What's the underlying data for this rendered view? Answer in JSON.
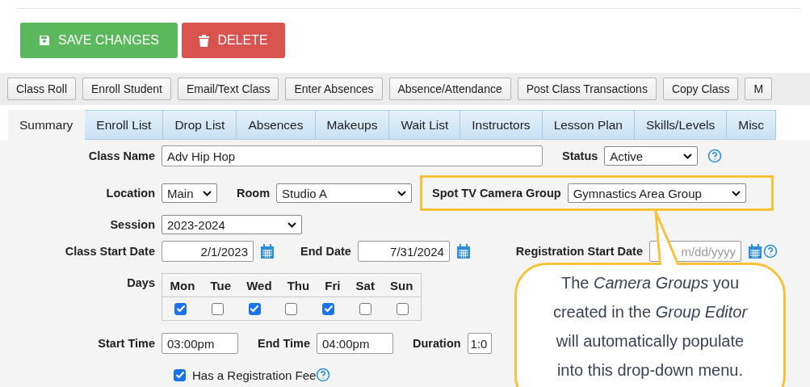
{
  "actions": [
    {
      "label": "SAVE CHANGES",
      "kind": "save"
    },
    {
      "label": "DELETE",
      "kind": "delete"
    }
  ],
  "toolbar": [
    "Class Roll",
    "Enroll Student",
    "Email/Text Class",
    "Enter Absences",
    "Absence/Attendance",
    "Post Class Transactions",
    "Copy Class",
    "M"
  ],
  "tabs": [
    {
      "label": "Summary",
      "selected": true
    },
    {
      "label": "Enroll List",
      "selected": false
    },
    {
      "label": "Drop List",
      "selected": false
    },
    {
      "label": "Absences",
      "selected": false
    },
    {
      "label": "Makeups",
      "selected": false
    },
    {
      "label": "Wait List",
      "selected": false
    },
    {
      "label": "Instructors",
      "selected": false
    },
    {
      "label": "Lesson Plan",
      "selected": false
    },
    {
      "label": "Skills/Levels",
      "selected": false
    },
    {
      "label": "Misc",
      "selected": false
    }
  ],
  "form": {
    "class_name": {
      "label": "Class Name",
      "value": "Adv Hip Hop"
    },
    "status": {
      "label": "Status",
      "value": "Active"
    },
    "location": {
      "label": "Location",
      "value": "Main"
    },
    "room": {
      "label": "Room",
      "value": "Studio A"
    },
    "camera_group": {
      "label": "Spot TV Camera Group",
      "value": "Gymnastics Area Group"
    },
    "session": {
      "label": "Session",
      "value": "2023-2024"
    },
    "class_start_date": {
      "label": "Class Start Date",
      "value": "2/1/2023"
    },
    "end_date": {
      "label": "End Date",
      "value": "7/31/2024"
    },
    "registration_start_date": {
      "label": "Registration Start Date",
      "placeholder": "m/dd/yyyy"
    },
    "days": {
      "label": "Days",
      "items": [
        {
          "label": "Mon",
          "checked": true
        },
        {
          "label": "Tue",
          "checked": false
        },
        {
          "label": "Wed",
          "checked": true
        },
        {
          "label": "Thu",
          "checked": false
        },
        {
          "label": "Fri",
          "checked": true
        },
        {
          "label": "Sat",
          "checked": false
        },
        {
          "label": "Sun",
          "checked": false
        }
      ]
    },
    "start_time": {
      "label": "Start Time",
      "value": "03:00pm"
    },
    "end_time": {
      "label": "End Time",
      "value": "04:00pm"
    },
    "duration": {
      "label": "Duration",
      "value": "1:0"
    },
    "registration_fee": {
      "label": "Has a Registration Fee",
      "checked": true
    }
  },
  "callout": {
    "text": "The *Camera Groups* you created in the *Group Editor* will automatically populate into this drop-down menu."
  }
}
